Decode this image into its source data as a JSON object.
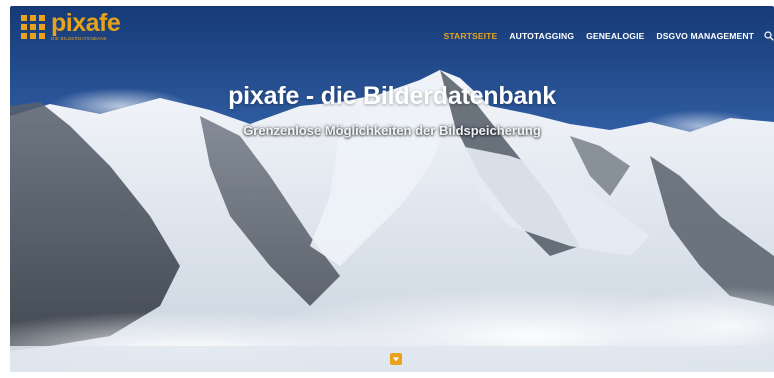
{
  "header": {
    "logo": {
      "name": "pixafe",
      "tagline": "DIE BILDERDATENBANK"
    },
    "nav": [
      {
        "label": "STARTSEITE",
        "active": true
      },
      {
        "label": "AUTOTAGGING",
        "active": false
      },
      {
        "label": "GENEALOGIE",
        "active": false
      },
      {
        "label": "DSGVO MANAGEMENT",
        "active": false
      }
    ],
    "search_icon": "search-icon"
  },
  "hero": {
    "title": "pixafe - die Bilderdatenbank",
    "subtitle": "Grenzenlose Möglichkeiten der Bildspeicherung",
    "scroll_icon": "chevron-down-icon"
  },
  "colors": {
    "accent": "#e8a21d",
    "nav_text": "#ffffff",
    "sky_top": "#173c78",
    "sky_bottom": "#5a8fd0"
  }
}
